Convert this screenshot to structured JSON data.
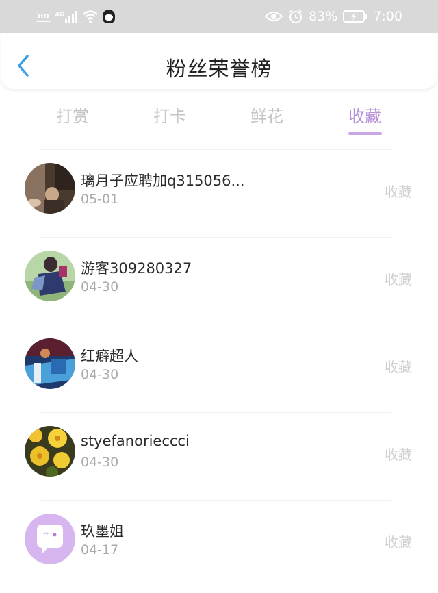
{
  "status_bar": {
    "hd": "HD",
    "signal": "4G",
    "battery_percent": "83%",
    "time": "7:00",
    "icons": [
      "hd-icon",
      "signal-icon",
      "wifi-icon",
      "qq-icon",
      "eye-icon",
      "alarm-icon",
      "battery-icon"
    ]
  },
  "header": {
    "title": "粉丝荣誉榜",
    "back_icon": "back-chevron-icon"
  },
  "tabs": [
    {
      "label": "打赏",
      "active": false
    },
    {
      "label": "打卡",
      "active": false
    },
    {
      "label": "鲜花",
      "active": false
    },
    {
      "label": "收藏",
      "active": true
    }
  ],
  "accent_color": "#c9a6e8",
  "fans": [
    {
      "name": "璃月子应聘加q315056...",
      "date": "05-01",
      "action": "收藏"
    },
    {
      "name": "游客309280327",
      "date": "04-30",
      "action": "收藏"
    },
    {
      "name": "红癖超人",
      "date": "04-30",
      "action": "收藏"
    },
    {
      "name": "styefanorieccci",
      "date": "04-30",
      "action": "收藏"
    },
    {
      "name": "玖墨姐",
      "date": "04-17",
      "action": "收藏"
    }
  ]
}
